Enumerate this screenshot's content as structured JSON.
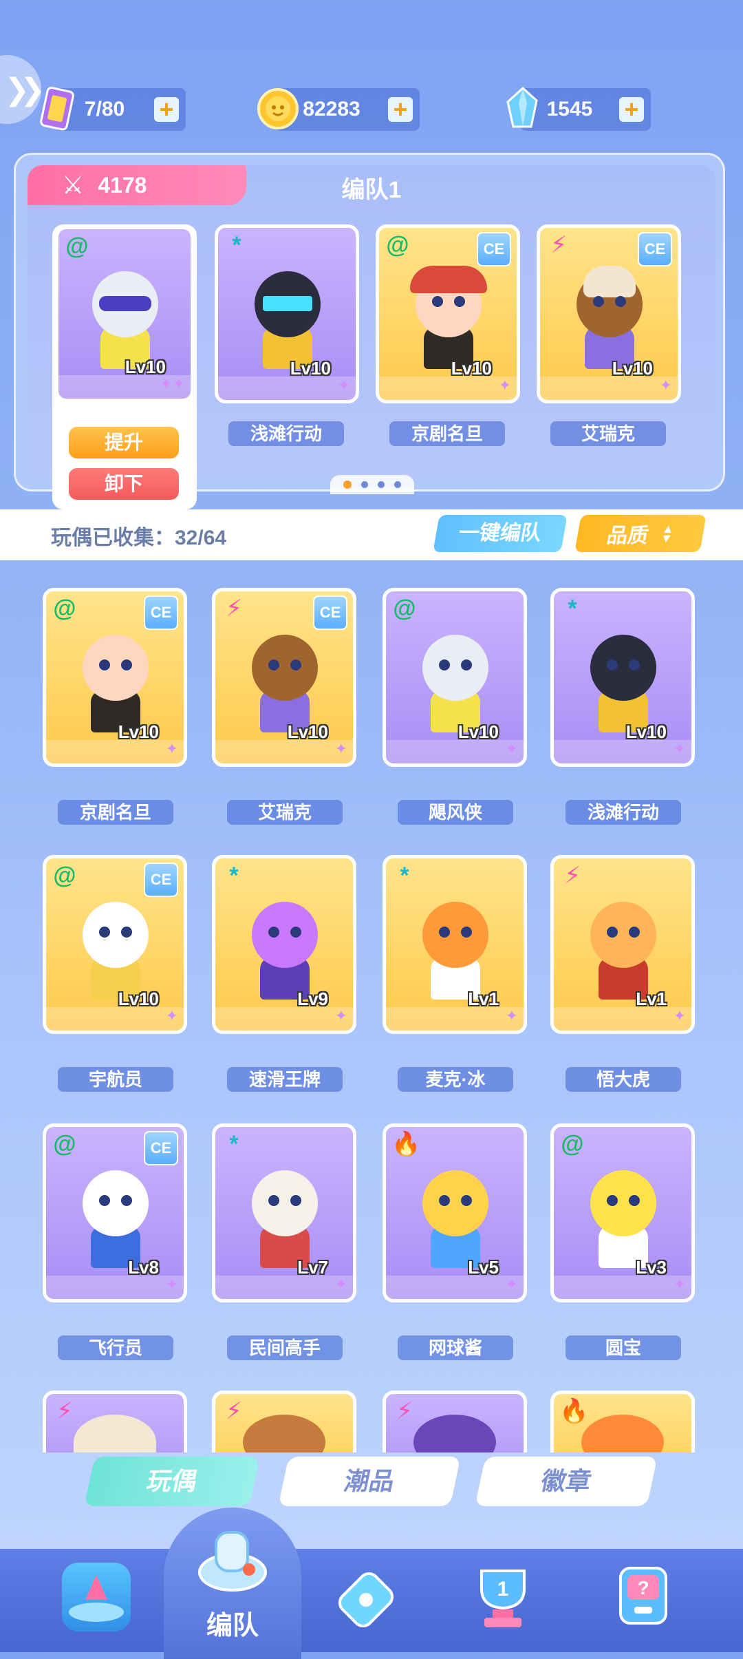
{
  "currencies": [
    {
      "icon": "ticket-icon",
      "value": "7/80"
    },
    {
      "icon": "coin-icon",
      "value": "82283"
    },
    {
      "icon": "crystal-icon",
      "value": "1545"
    }
  ],
  "team": {
    "power": "4178",
    "title": "编队1",
    "selected_level": "Lv10",
    "upgrade_label": "提升",
    "unload_label": "卸下",
    "members": [
      {
        "name": "浅滩行动",
        "level": "Lv10",
        "elem": "*"
      },
      {
        "name": "京剧名旦",
        "level": "Lv10",
        "elem": "@"
      },
      {
        "name": "艾瑞克",
        "level": "Lv10",
        "elem": "⚡"
      }
    ]
  },
  "collection": {
    "label": "玩偶已收集：32/64",
    "oneclick_label": "一键编队",
    "quality_label": "品质"
  },
  "dolls": [
    {
      "name": "京剧名旦",
      "level": "Lv10",
      "elem": "@",
      "ce": "CE",
      "theme": "gold"
    },
    {
      "name": "艾瑞克",
      "level": "Lv10",
      "elem": "⚡",
      "ce": "CE",
      "theme": "gold"
    },
    {
      "name": "飓风侠",
      "level": "Lv10",
      "elem": "@",
      "ce": "",
      "theme": "purple"
    },
    {
      "name": "浅滩行动",
      "level": "Lv10",
      "elem": "*",
      "ce": "",
      "theme": "purple"
    },
    {
      "name": "宇航员",
      "level": "Lv10",
      "elem": "@",
      "ce": "CE",
      "theme": "gold"
    },
    {
      "name": "速滑王牌",
      "level": "Lv9",
      "elem": "*",
      "ce": "",
      "theme": "gold"
    },
    {
      "name": "麦克·冰",
      "level": "Lv1",
      "elem": "*",
      "ce": "",
      "theme": "gold"
    },
    {
      "name": "悟大虎",
      "level": "Lv1",
      "elem": "⚡",
      "ce": "",
      "theme": "gold"
    },
    {
      "name": "飞行员",
      "level": "Lv8",
      "elem": "@",
      "ce": "CE",
      "theme": "purple"
    },
    {
      "name": "民间高手",
      "level": "Lv7",
      "elem": "*",
      "ce": "",
      "theme": "purple"
    },
    {
      "name": "网球酱",
      "level": "Lv5",
      "elem": "🔥",
      "ce": "",
      "theme": "purple"
    },
    {
      "name": "圆宝",
      "level": "Lv3",
      "elem": "@",
      "ce": "",
      "theme": "purple"
    }
  ],
  "tabs": [
    {
      "label": "玩偶",
      "active": true
    },
    {
      "label": "潮品",
      "active": false
    },
    {
      "label": "徽章",
      "active": false
    }
  ],
  "nav": {
    "active_label": "编队"
  },
  "colors": {
    "accent_pink": "#ff6fa5",
    "accent_orange": "#ff9f1a",
    "accent_cyan": "#6fe3d8"
  }
}
